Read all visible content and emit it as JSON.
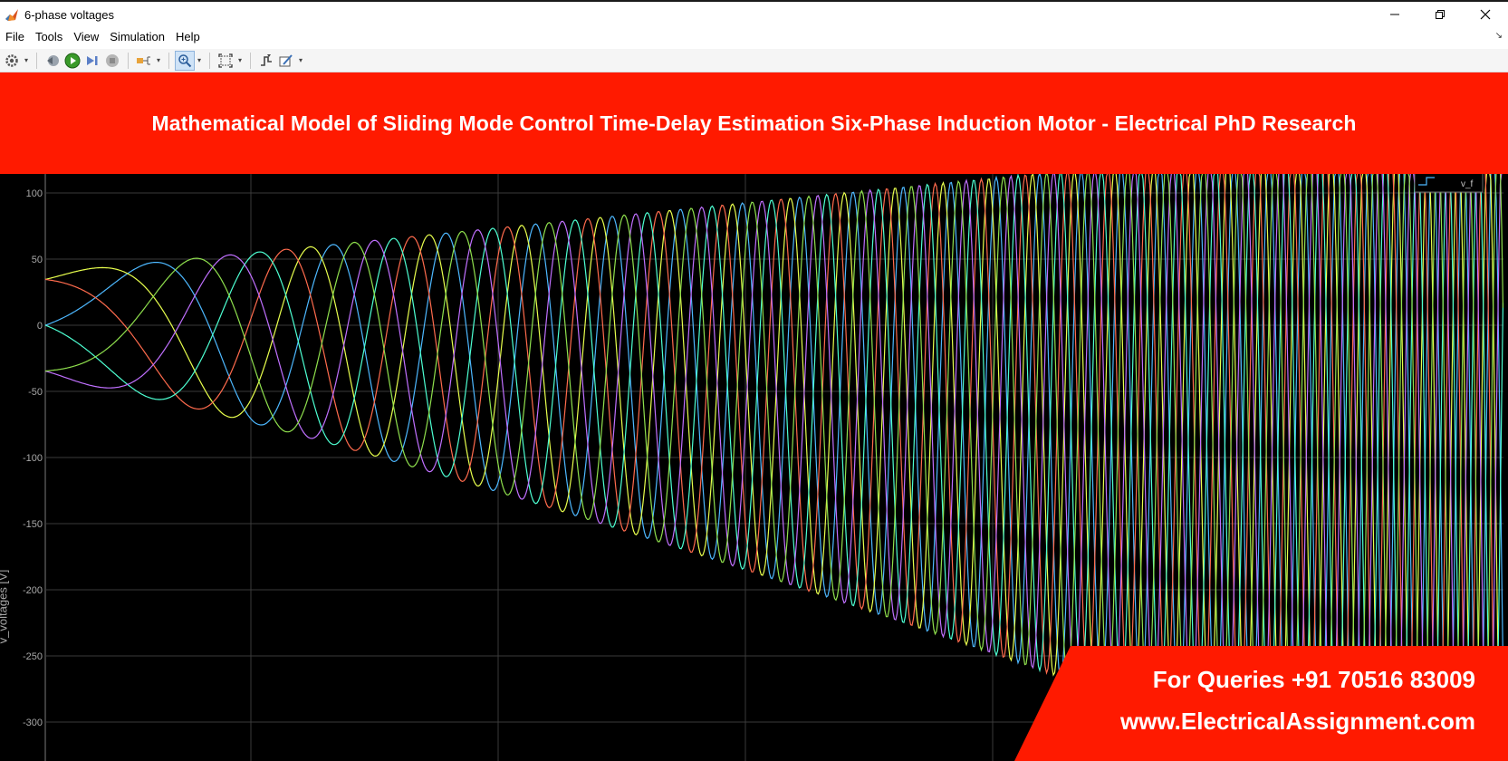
{
  "window": {
    "title": "6-phase voltages",
    "controls": [
      "minimize-icon",
      "restore-icon",
      "close-icon"
    ]
  },
  "menu": {
    "items": [
      "File",
      "Tools",
      "View",
      "Simulation",
      "Help"
    ]
  },
  "toolbar": {
    "buttons": [
      "settings-icon",
      "step-back-icon",
      "run-icon",
      "step-forward-icon",
      "stop-icon",
      "signal-select-icon",
      "zoom-icon",
      "fit-to-view-icon",
      "triggers-icon",
      "style-icon"
    ]
  },
  "banner": {
    "title": "Mathematical Model of Sliding Mode Control Time-Delay Estimation Six-Phase Induction Motor - Electrical PhD Research",
    "color": "#ff1a00"
  },
  "contact": {
    "phone": "For Queries +91 70516 83009",
    "website": "www.ElectricalAssignment.com"
  },
  "chart_data": {
    "type": "line",
    "title": "",
    "xlabel": "",
    "ylabel": "v_voltages [V]",
    "ylim": [
      -330,
      110
    ],
    "yticks": [
      100,
      50,
      0,
      -50,
      -100,
      -150,
      -200,
      -250,
      -300
    ],
    "grid": true,
    "background": "#000000",
    "legend": {
      "placement": "top-right",
      "entries": [
        "v_f"
      ]
    },
    "series": [
      {
        "color": "#4db8ff",
        "phase_deg": 0
      },
      {
        "color": "#e8ff4d",
        "phase_deg": 60
      },
      {
        "color": "#ff6b4d",
        "phase_deg": 120
      },
      {
        "color": "#4dffd2",
        "phase_deg": 180
      },
      {
        "color": "#c070ff",
        "phase_deg": 240
      },
      {
        "color": "#8fe04d",
        "phase_deg": 300
      }
    ],
    "envelope": {
      "amplitude_start": 40,
      "amplitude_end": 270,
      "offset_start": 0,
      "offset_end": -120
    }
  }
}
